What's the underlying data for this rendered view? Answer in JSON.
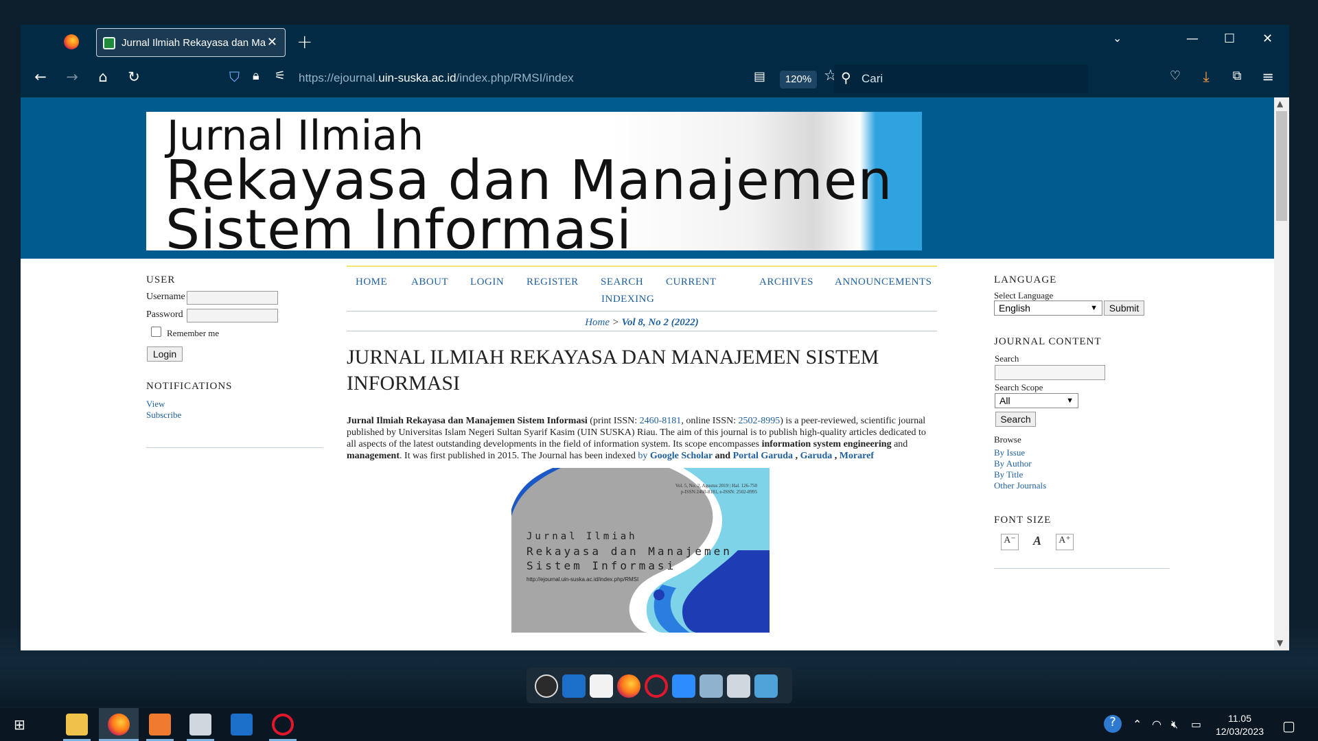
{
  "browser": {
    "tab_title": "Jurnal Ilmiah Rekayasa dan Manajemen",
    "url_prefix": "https://ejournal.",
    "url_domain": "uin-suska.ac.id",
    "url_path": "/index.php/RMSI/index",
    "zoom": "120%",
    "search_placeholder": "Cari"
  },
  "banner": {
    "line1": "Jurnal Ilmiah",
    "line2": "Rekayasa dan Manajemen",
    "line3": "Sistem Informasi"
  },
  "left_sidebar": {
    "user_heading": "USER",
    "username_label": "Username",
    "password_label": "Password",
    "remember_label": "Remember me",
    "login_button": "Login",
    "notifications_heading": "NOTIFICATIONS",
    "view_link": "View",
    "subscribe_link": "Subscribe"
  },
  "nav": {
    "home": "HOME",
    "about": "ABOUT",
    "login": "LOGIN",
    "register": "REGISTER",
    "search": "SEARCH",
    "current": "CURRENT",
    "archives": "ARCHIVES",
    "announcements": "ANNOUNCEMENTS",
    "indexing": "INDEXING"
  },
  "breadcrumb": {
    "home": "Home",
    "sep": " > ",
    "current": "Vol 8, No 2 (2022)"
  },
  "journal": {
    "title": "JURNAL ILMIAH REKAYASA DAN MANAJEMEN SISTEM INFORMASI",
    "desc_name": "Jurnal Ilmiah Rekayasa dan Manajemen Sistem Informasi",
    "desc_p1": " (print ISSN: ",
    "issn_print": "2460-8181",
    "desc_p2": ", online ISSN: ",
    "issn_online": "2502-8995",
    "desc_p3": ") is a peer-reviewed, scientific journal published by Universitas Islam Negeri Sultan Syarif Kasim (UIN SUSKA) Riau. The aim of this journal is to publish high-quality articles dedicated to all aspects of the latest outstanding developments in the field of information system. Its scope encompasses ",
    "desc_b1": "information system engineering",
    "desc_and": " and ",
    "desc_b2": "management",
    "desc_p4": ". It was first published in 2015. The Journal has been indexed ",
    "desc_by": "by ",
    "idx_google": "Google Scholar",
    "desc_and2": " and ",
    "idx_portal": "Portal Garuda",
    "desc_comma1": " ,  ",
    "idx_garuda": "Garuda",
    "desc_comma2": " , ",
    "idx_moraref": "Moraref"
  },
  "cover": {
    "line1": "Jurnal Ilmiah",
    "line2": "Rekayasa dan Manajemen",
    "line3": "Sistem Informasi",
    "vol": "Vol. 5, No. 2, Agustus 2019 | Hal. 126-750",
    "issn": "p-ISSN:2460-8181, e-ISSN: 2502-8995",
    "url": "http://ejournal.uin-suska.ac.id/index.php/RMSI"
  },
  "right_sidebar": {
    "language_heading": "LANGUAGE",
    "select_language_label": "Select Language",
    "language_value": "English",
    "submit_button": "Submit",
    "content_heading": "JOURNAL CONTENT",
    "search_label": "Search",
    "scope_label": "Search Scope",
    "scope_value": "All",
    "search_button": "Search",
    "browse_label": "Browse",
    "by_issue": "By Issue",
    "by_author": "By Author",
    "by_title": "By Title",
    "other_journals": "Other Journals",
    "font_heading": "FONT SIZE"
  },
  "taskbar": {
    "time": "11.05",
    "date": "12/03/2023"
  },
  "colors": {
    "header_blue": "#005c8f",
    "link_blue": "#1f5f9e",
    "browser_chrome": "#012a45"
  }
}
